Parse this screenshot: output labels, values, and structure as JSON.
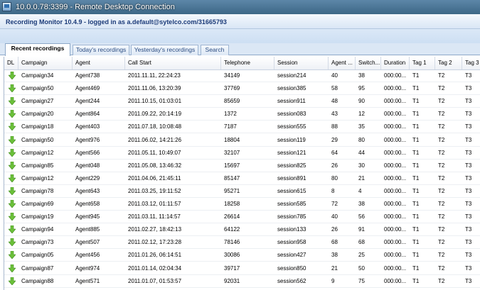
{
  "window": {
    "title": "10.0.0.78:3399 - Remote Desktop Connection"
  },
  "header": {
    "status": "Recording Monitor 10.4.9 - logged in as a.default@sytelco.com/31665793"
  },
  "tabs": [
    {
      "label": "Recent recordings",
      "active": true
    },
    {
      "label": "Today's recordings",
      "active": false
    },
    {
      "label": "Yesterday's recordings",
      "active": false
    },
    {
      "label": "Search",
      "active": false
    }
  ],
  "columns": [
    "DL",
    "Campaign",
    "Agent",
    "Call Start",
    "Telephone",
    "Session",
    "Agent ...",
    "Switch...",
    "Duration",
    "Tag 1",
    "Tag 2",
    "Tag 3"
  ],
  "icons": {
    "download": "download-arrow-icon"
  },
  "colors": {
    "download_arrow": "#6cc13a",
    "titlebar": "#4a7597"
  },
  "rows": [
    {
      "campaign": "Campaign34",
      "agent": "Agent738",
      "call_start": "2011.11.11, 22:24:23",
      "telephone": "34149",
      "session": "session214",
      "agent_col": "40",
      "switch": "38",
      "duration": "000:00...",
      "tag1": "T1",
      "tag2": "T2",
      "tag3": "T3"
    },
    {
      "campaign": "Campaign50",
      "agent": "Agent469",
      "call_start": "2011.11.06, 13:20:39",
      "telephone": "37769",
      "session": "session385",
      "agent_col": "58",
      "switch": "95",
      "duration": "000:00...",
      "tag1": "T1",
      "tag2": "T2",
      "tag3": "T3"
    },
    {
      "campaign": "Campaign27",
      "agent": "Agent244",
      "call_start": "2011.10.15, 01:03:01",
      "telephone": "85659",
      "session": "session911",
      "agent_col": "48",
      "switch": "90",
      "duration": "000:00...",
      "tag1": "T1",
      "tag2": "T2",
      "tag3": "T3"
    },
    {
      "campaign": "Campaign20",
      "agent": "Agent864",
      "call_start": "2011.09.22, 20:14:19",
      "telephone": "1372",
      "session": "session083",
      "agent_col": "43",
      "switch": "12",
      "duration": "000:00...",
      "tag1": "T1",
      "tag2": "T2",
      "tag3": "T3"
    },
    {
      "campaign": "Campaign18",
      "agent": "Agent403",
      "call_start": "2011.07.18, 10:08:48",
      "telephone": "7187",
      "session": "session555",
      "agent_col": "88",
      "switch": "35",
      "duration": "000:00...",
      "tag1": "T1",
      "tag2": "T2",
      "tag3": "T3"
    },
    {
      "campaign": "Campaign50",
      "agent": "Agent976",
      "call_start": "2011.06.02, 14:21:26",
      "telephone": "18804",
      "session": "session119",
      "agent_col": "29",
      "switch": "80",
      "duration": "000:00...",
      "tag1": "T1",
      "tag2": "T2",
      "tag3": "T3"
    },
    {
      "campaign": "Campaign12",
      "agent": "Agent566",
      "call_start": "2011.05.11, 10:49:07",
      "telephone": "32107",
      "session": "session121",
      "agent_col": "64",
      "switch": "44",
      "duration": "000:00...",
      "tag1": "T1",
      "tag2": "T2",
      "tag3": "T3"
    },
    {
      "campaign": "Campaign85",
      "agent": "Agent048",
      "call_start": "2011.05.08, 13:46:32",
      "telephone": "15697",
      "session": "session825",
      "agent_col": "26",
      "switch": "30",
      "duration": "000:00...",
      "tag1": "T1",
      "tag2": "T2",
      "tag3": "T3"
    },
    {
      "campaign": "Campaign12",
      "agent": "Agent229",
      "call_start": "2011.04.06, 21:45:11",
      "telephone": "85147",
      "session": "session891",
      "agent_col": "80",
      "switch": "21",
      "duration": "000:00...",
      "tag1": "T1",
      "tag2": "T2",
      "tag3": "T3"
    },
    {
      "campaign": "Campaign78",
      "agent": "Agent643",
      "call_start": "2011.03.25, 19:11:52",
      "telephone": "95271",
      "session": "session615",
      "agent_col": "8",
      "switch": "4",
      "duration": "000:00...",
      "tag1": "T1",
      "tag2": "T2",
      "tag3": "T3"
    },
    {
      "campaign": "Campaign69",
      "agent": "Agent658",
      "call_start": "2011.03.12, 01:11:57",
      "telephone": "18258",
      "session": "session585",
      "agent_col": "72",
      "switch": "38",
      "duration": "000:00...",
      "tag1": "T1",
      "tag2": "T2",
      "tag3": "T3"
    },
    {
      "campaign": "Campaign19",
      "agent": "Agent945",
      "call_start": "2011.03.11, 11:14:57",
      "telephone": "26614",
      "session": "session785",
      "agent_col": "40",
      "switch": "56",
      "duration": "000:00...",
      "tag1": "T1",
      "tag2": "T2",
      "tag3": "T3"
    },
    {
      "campaign": "Campaign94",
      "agent": "Agent885",
      "call_start": "2011.02.27, 18:42:13",
      "telephone": "64122",
      "session": "session133",
      "agent_col": "26",
      "switch": "91",
      "duration": "000:00...",
      "tag1": "T1",
      "tag2": "T2",
      "tag3": "T3"
    },
    {
      "campaign": "Campaign73",
      "agent": "Agent507",
      "call_start": "2011.02.12, 17:23:28",
      "telephone": "78146",
      "session": "session958",
      "agent_col": "68",
      "switch": "68",
      "duration": "000:00...",
      "tag1": "T1",
      "tag2": "T2",
      "tag3": "T3"
    },
    {
      "campaign": "Campaign05",
      "agent": "Agent456",
      "call_start": "2011.01.26, 06:14:51",
      "telephone": "30086",
      "session": "session427",
      "agent_col": "38",
      "switch": "25",
      "duration": "000:00...",
      "tag1": "T1",
      "tag2": "T2",
      "tag3": "T3"
    },
    {
      "campaign": "Campaign87",
      "agent": "Agent974",
      "call_start": "2011.01.14, 02:04:34",
      "telephone": "39717",
      "session": "session850",
      "agent_col": "21",
      "switch": "50",
      "duration": "000:00...",
      "tag1": "T1",
      "tag2": "T2",
      "tag3": "T3"
    },
    {
      "campaign": "Campaign88",
      "agent": "Agent571",
      "call_start": "2011.01.07, 01:53:57",
      "telephone": "92031",
      "session": "session562",
      "agent_col": "9",
      "switch": "75",
      "duration": "000:00...",
      "tag1": "T1",
      "tag2": "T2",
      "tag3": "T3"
    }
  ]
}
